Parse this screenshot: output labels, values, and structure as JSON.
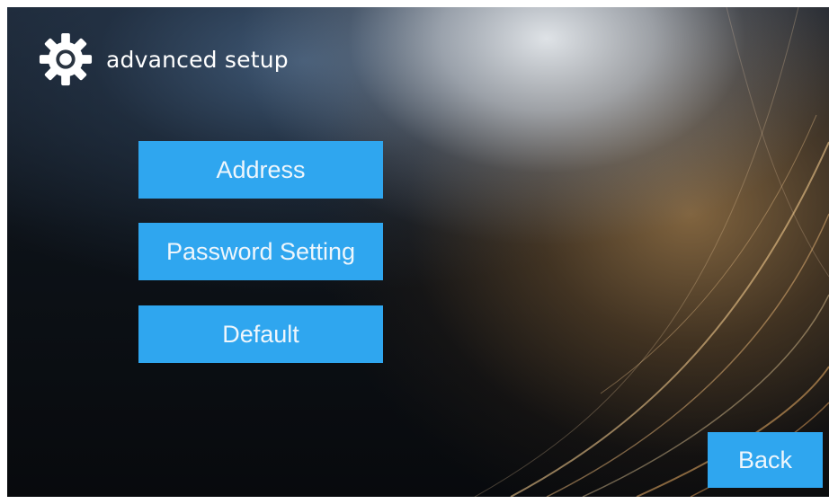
{
  "header": {
    "icon": "gear-icon",
    "title": "advanced setup"
  },
  "menu": {
    "items": [
      {
        "label": "Address"
      },
      {
        "label": "Password Setting"
      },
      {
        "label": "Default"
      }
    ]
  },
  "footer": {
    "back_label": "Back"
  },
  "colors": {
    "button_bg": "#2fa6ef",
    "button_text": "#eef6fc",
    "title_text": "#ffffff"
  }
}
